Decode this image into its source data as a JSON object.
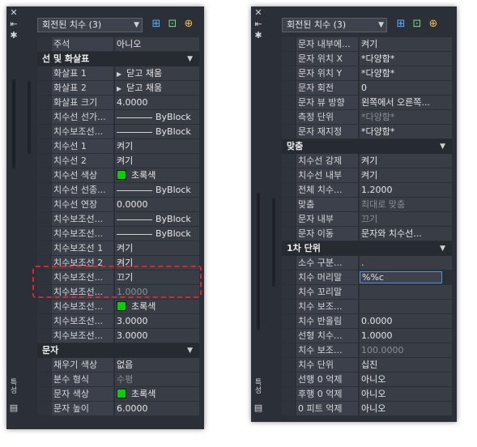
{
  "panelA": {
    "selector": "회전된 치수 (3)",
    "rows": [
      {
        "type": "row",
        "label": "주석",
        "value": "아니오"
      },
      {
        "type": "section",
        "label": "선 및 화살표"
      },
      {
        "type": "row",
        "label": "화살표 1",
        "value": "닫고 채움",
        "kind": "arrow"
      },
      {
        "type": "row",
        "label": "화살표 2",
        "value": "닫고 채움",
        "kind": "arrow"
      },
      {
        "type": "row",
        "label": "화살표 크기",
        "value": "4.0000"
      },
      {
        "type": "row",
        "label": "치수선 선가...",
        "value": "ByBlock",
        "kind": "line"
      },
      {
        "type": "row",
        "label": "치수보조선...",
        "value": "ByBlock",
        "kind": "line"
      },
      {
        "type": "row",
        "label": "치수선 1",
        "value": "켜기"
      },
      {
        "type": "row",
        "label": "치수선 2",
        "value": "켜기"
      },
      {
        "type": "row",
        "label": "치수선 색상",
        "value": "초록색",
        "kind": "color"
      },
      {
        "type": "row",
        "label": "치수선 선종...",
        "value": "ByBlock",
        "kind": "line"
      },
      {
        "type": "row",
        "label": "치수선 연장",
        "value": "0.0000"
      },
      {
        "type": "row",
        "label": "치수보조선...",
        "value": "ByBlock",
        "kind": "line"
      },
      {
        "type": "row",
        "label": "치수보조선...",
        "value": "ByBlock",
        "kind": "line"
      },
      {
        "type": "row",
        "label": "치수보조선 1",
        "value": "켜기"
      },
      {
        "type": "row",
        "label": "치수보조선 2",
        "value": "켜기"
      },
      {
        "type": "row",
        "label": "치수보조선...",
        "value": "끄기"
      },
      {
        "type": "row",
        "label": "치수보조선...",
        "value": "1.0000",
        "dim": true
      },
      {
        "type": "row",
        "label": "치수보조선...",
        "value": "초록색",
        "kind": "color"
      },
      {
        "type": "row",
        "label": "치수보조선...",
        "value": "3.0000"
      },
      {
        "type": "row",
        "label": "치수보조선...",
        "value": "3.0000"
      },
      {
        "type": "section",
        "label": "문자"
      },
      {
        "type": "row",
        "label": "채우기 색상",
        "value": "없음"
      },
      {
        "type": "row",
        "label": "분수 형식",
        "value": "수평",
        "dim": true
      },
      {
        "type": "row",
        "label": "문자 색상",
        "value": "초록색",
        "kind": "color"
      },
      {
        "type": "row",
        "label": "문자 높이",
        "value": "6.0000"
      }
    ]
  },
  "panelB": {
    "selector": "회전된 치수 (3)",
    "rows": [
      {
        "type": "row",
        "label": "문자 내부에...",
        "value": "켜기"
      },
      {
        "type": "row",
        "label": "문자 위치 X",
        "value": "*다양함*"
      },
      {
        "type": "row",
        "label": "문자 위치 Y",
        "value": "*다양함*"
      },
      {
        "type": "row",
        "label": "문자 회전",
        "value": "0"
      },
      {
        "type": "row",
        "label": "문자 뷰 방향",
        "value": "왼쪽에서 오른쪽..."
      },
      {
        "type": "row",
        "label": "측정 단위",
        "value": "*다양함*",
        "dim": true
      },
      {
        "type": "row",
        "label": "문자 재지정",
        "value": "*다양함*"
      },
      {
        "type": "section",
        "label": "맞춤"
      },
      {
        "type": "row",
        "label": "치수선 강제",
        "value": "켜기"
      },
      {
        "type": "row",
        "label": "치수선 내부",
        "value": "켜기"
      },
      {
        "type": "row",
        "label": "전체 치수...",
        "value": "1.2000"
      },
      {
        "type": "row",
        "label": "맞춤",
        "value": "최대로 맞춤",
        "dim": true
      },
      {
        "type": "row",
        "label": "문자 내부",
        "value": "끄기",
        "dim": true
      },
      {
        "type": "row",
        "label": "문자 이동",
        "value": "문자와 치수선..."
      },
      {
        "type": "section",
        "label": "1차 단위"
      },
      {
        "type": "row",
        "label": "소수 구분...",
        "value": "."
      },
      {
        "type": "row",
        "label": "치수 머리말",
        "value": "%%c",
        "kind": "edit"
      },
      {
        "type": "row",
        "label": "치수 꼬리말",
        "value": ""
      },
      {
        "type": "row",
        "label": "치수 보조...",
        "value": ""
      },
      {
        "type": "row",
        "label": "치수 반올림",
        "value": "0.0000"
      },
      {
        "type": "row",
        "label": "선형 치수...",
        "value": "1.0000"
      },
      {
        "type": "row",
        "label": "치수 보조...",
        "value": "100.0000",
        "dim": true
      },
      {
        "type": "row",
        "label": "치수 단위",
        "value": "십진"
      },
      {
        "type": "row",
        "label": "선행 0 억제",
        "value": "아니오"
      },
      {
        "type": "row",
        "label": "후행 0 억제",
        "value": "아니오"
      },
      {
        "type": "row",
        "label": "0 피트 억제",
        "value": "아니오"
      }
    ]
  },
  "sideStrip": {
    "vertical_label": "특성"
  },
  "colors": {
    "panel": "#2b2f38",
    "label_bg": "#3b404a",
    "value_bg": "#393d46",
    "section_bg": "#262a31",
    "green": "#00d400",
    "highlight": "#d9262c"
  },
  "icons": [
    "close-icon",
    "pin-icon",
    "settings-icon",
    "quick-select-icon",
    "select-objects-icon",
    "toggle-pickadd-icon"
  ]
}
